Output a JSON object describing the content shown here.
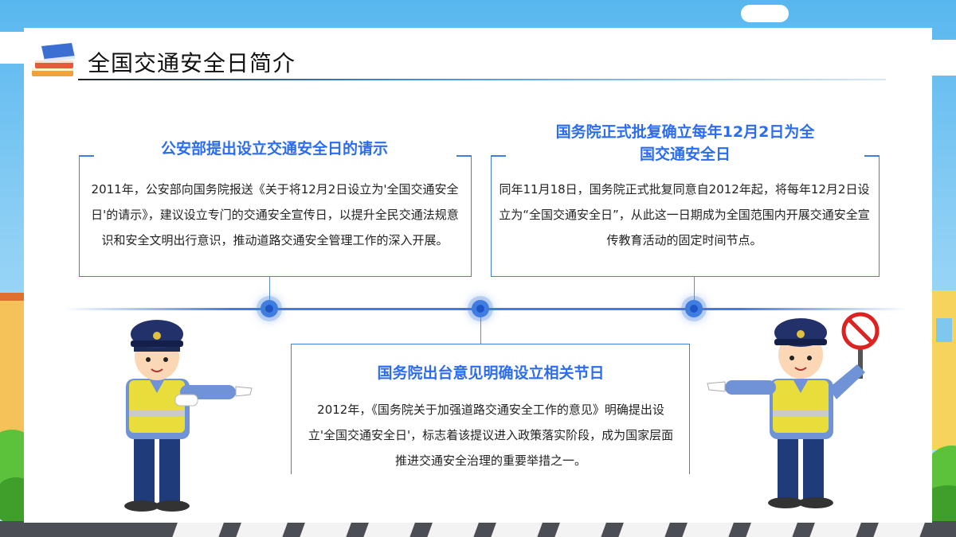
{
  "header": {
    "title": "全国交通安全日简介"
  },
  "events": [
    {
      "heading": "公安部提出设立交通安全日的请示",
      "text": "2011年，公安部向国务院报送《关于将12月2日设立为'全国交通安全日'的请示》，建议设立专门的交通安全宣传日，以提升全民交通法规意识和安全文明出行意识，推动道路交通安全管理工作的深入开展。"
    },
    {
      "heading": "国务院出台意见明确设立相关节日",
      "text": "2012年，《国务院关于加强道路交通安全工作的意见》明确提出设立'全国交通安全日'，标志着该提议进入政策落实阶段，成为国家层面推进交通安全治理的重要举措之一。"
    },
    {
      "heading": "国务院正式批复确立每年12月2日为全国交通安全日",
      "text": "同年11月18日，国务院正式批复同意自2012年起，将每年12月2日设立为“全国交通安全日”，从此这一日期成为全国范围内开展交通安全宣传教育活动的固定时间节点。"
    }
  ],
  "colors": {
    "accent": "#3f7de0",
    "heading": "#2c6cf0",
    "vest": "#e8dd3a",
    "uniform": "#1f3b7a"
  },
  "icons": [
    "books-icon",
    "police-officer-left",
    "police-officer-right",
    "no-entry-sign-icon"
  ]
}
